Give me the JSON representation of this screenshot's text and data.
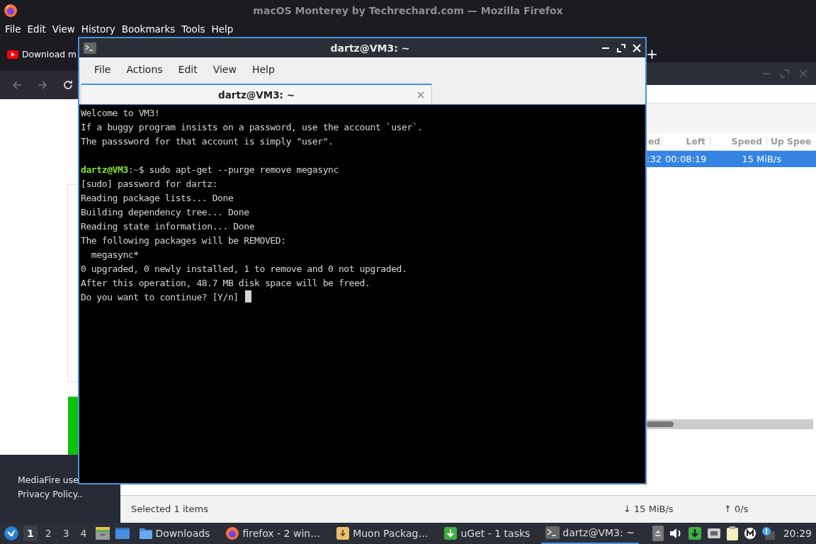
{
  "firefox": {
    "title": "macOS Monterey by Techrechard.com — Mozilla Firefox",
    "menu": [
      "File",
      "Edit",
      "View",
      "History",
      "Bookmarks",
      "Tools",
      "Help"
    ],
    "tab": {
      "label": "Download m"
    },
    "new_tab": "+",
    "footer": [
      "MediaFire use",
      "Privacy Policy.."
    ]
  },
  "uget": {
    "columns": [
      "ed",
      "Left",
      "Speed",
      "Up Spee"
    ],
    "rows": [
      {
        "cells": [
          ":32",
          "00:08:19",
          "15 MiB/s"
        ],
        "selected": true
      }
    ],
    "status": {
      "selection": "Selected 1 items",
      "down": "↓ 15 MiB/s",
      "up": "↑ 0/s"
    }
  },
  "terminal": {
    "title": "dartz@VM3: ~",
    "menu": [
      "File",
      "Actions",
      "Edit",
      "View",
      "Help"
    ],
    "tabs": [
      {
        "label": "dartz@VM3: ~",
        "selected": true
      }
    ],
    "lines": [
      [
        {
          "kind": "plain",
          "text": "Welcome to VM3!"
        }
      ],
      [
        {
          "kind": "plain",
          "text": "If a buggy program insists on a password, use the account `user`."
        }
      ],
      [
        {
          "kind": "plain",
          "text": "The passsword for that account is simply \"user\"."
        }
      ],
      [
        {
          "kind": "blank"
        }
      ],
      [
        {
          "kind": "user",
          "text": "dartz@VM3"
        },
        {
          "kind": "plain",
          "text": ":"
        },
        {
          "kind": "path",
          "text": "~"
        },
        {
          "kind": "plain",
          "text": "$ sudo apt-get --purge remove megasync"
        }
      ],
      [
        {
          "kind": "plain",
          "text": "[sudo] password for dartz:"
        }
      ],
      [
        {
          "kind": "plain",
          "text": "Reading package lists... Done"
        }
      ],
      [
        {
          "kind": "plain",
          "text": "Building dependency tree... Done"
        }
      ],
      [
        {
          "kind": "plain",
          "text": "Reading state information... Done"
        }
      ],
      [
        {
          "kind": "plain",
          "text": "The following packages will be REMOVED:"
        }
      ],
      [
        {
          "kind": "plain",
          "text": "  megasync*"
        }
      ],
      [
        {
          "kind": "plain",
          "text": "0 upgraded, 0 newly installed, 1 to remove and 0 not upgraded."
        }
      ],
      [
        {
          "kind": "plain",
          "text": "After this operation, 48.7 MB disk space will be freed."
        }
      ],
      [
        {
          "kind": "plain",
          "text": "Do you want to continue? [Y/n] "
        },
        {
          "kind": "cursor"
        }
      ]
    ]
  },
  "taskbar": {
    "workspaces": [
      {
        "label": "1",
        "selected": true
      },
      {
        "label": "2",
        "selected": false
      },
      {
        "label": "3",
        "selected": false
      },
      {
        "label": "4",
        "selected": false
      }
    ],
    "tasks": [
      {
        "kind": "folder",
        "label": "Downloads",
        "selected": false
      },
      {
        "kind": "firefox",
        "label": "firefox - 2 win…",
        "selected": false
      },
      {
        "kind": "package",
        "label": "Muon Packag…",
        "selected": false
      },
      {
        "kind": "download",
        "label": "uGet - 1 tasks",
        "selected": false
      },
      {
        "kind": "terminal",
        "label": "dartz@VM3: ~",
        "selected": true
      }
    ],
    "clock": "20:29"
  }
}
